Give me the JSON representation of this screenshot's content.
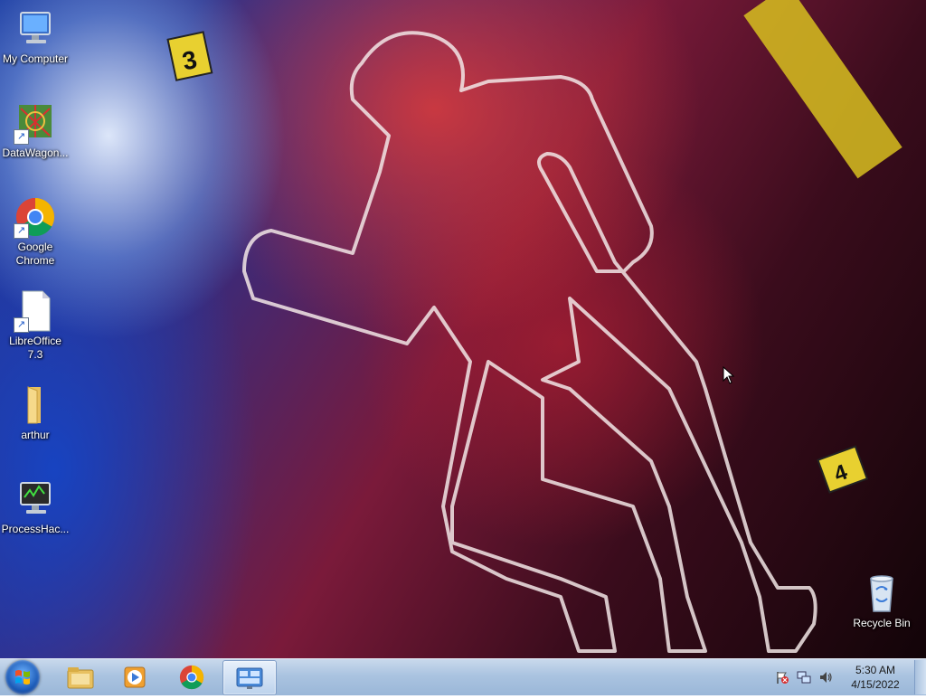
{
  "desktop": {
    "icons": [
      {
        "label": "My Computer",
        "icon": "computer-icon"
      },
      {
        "label": "DataWagon...",
        "icon": "datawagon-icon"
      },
      {
        "label": "Google Chrome",
        "icon": "chrome-icon"
      },
      {
        "label": "LibreOffice 7.3",
        "icon": "libreoffice-icon"
      },
      {
        "label": "arthur",
        "icon": "folder-icon"
      },
      {
        "label": "ProcessHac...",
        "icon": "processhacker-icon"
      },
      {
        "label": "Recycle Bin",
        "icon": "recycle-bin-icon"
      }
    ],
    "wallpaper_markers": [
      "3",
      "4"
    ]
  },
  "taskbar": {
    "pinned": [
      {
        "name": "file-explorer-icon"
      },
      {
        "name": "media-player-icon"
      },
      {
        "name": "chrome-icon"
      },
      {
        "name": "control-panel-icon",
        "active": true
      }
    ],
    "tray_icons": [
      "action-center-flag-icon",
      "network-icon",
      "volume-icon"
    ],
    "clock": {
      "time": "5:30 AM",
      "date": "4/15/2022"
    }
  },
  "colors": {
    "taskbar_top": "#c9d9ec",
    "taskbar_bottom": "#9ab7d8",
    "outline": "#f2e6e6"
  }
}
